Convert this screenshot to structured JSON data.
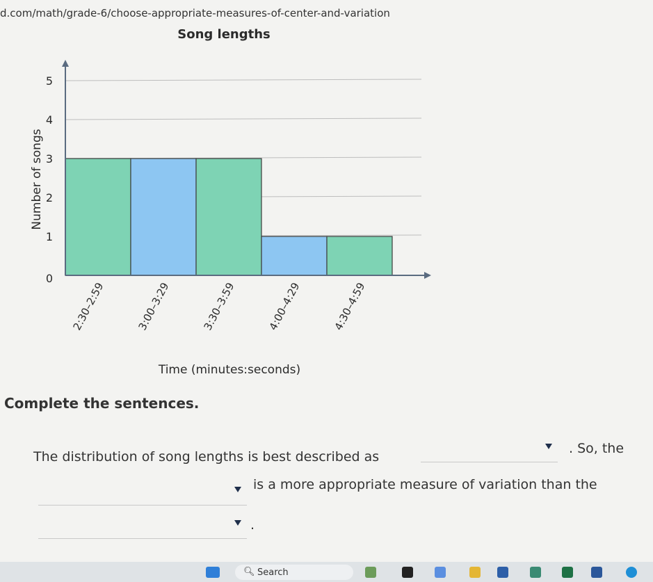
{
  "browser": {
    "url": "d.com/math/grade-6/choose-appropriate-measures-of-center-and-variation"
  },
  "chart_data": {
    "type": "bar",
    "title": "Song lengths",
    "xlabel": "Time (minutes:seconds)",
    "ylabel": "Number of songs",
    "categories": [
      "2:30–2:59",
      "3:00–3:29",
      "3:30–3:59",
      "4:00–4:29",
      "4:30–4:59"
    ],
    "values": [
      3,
      3,
      3,
      1,
      1
    ],
    "ylim": [
      0,
      5
    ],
    "yticks": [
      "0",
      "1",
      "2",
      "3",
      "4",
      "5"
    ],
    "grid": true,
    "colors": [
      "#7ed3b4",
      "#8dc6f2",
      "#7ed3b4",
      "#8dc6f2",
      "#7ed3b4"
    ]
  },
  "question": {
    "prompt": "Complete the sentences.",
    "line1_text": "The distribution of song lengths is best described as",
    "line1_after": ". So, the",
    "line2_after": "is a more appropriate measure of variation than the",
    "line3_after": "."
  },
  "taskbar": {
    "search_label": "Search"
  }
}
